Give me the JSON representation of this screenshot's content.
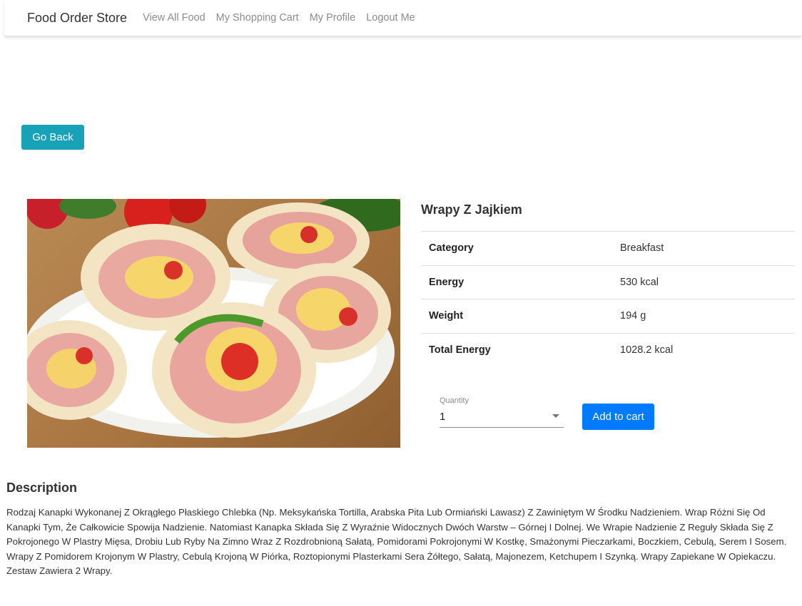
{
  "navbar": {
    "brand": "Food Order Store",
    "links": [
      "View All Food",
      "My Shopping Cart",
      "My Profile",
      "Logout Me"
    ]
  },
  "go_back_label": "Go Back",
  "food": {
    "title": "Wrapy Z Jajkiem",
    "details": [
      {
        "label": "Category",
        "value": "Breakfast"
      },
      {
        "label": "Energy",
        "value": "530 kcal"
      },
      {
        "label": "Weight",
        "value": "194 g"
      },
      {
        "label": "Total Energy",
        "value": "1028.2 kcal"
      }
    ]
  },
  "quantity": {
    "label": "Quantity",
    "value": "1"
  },
  "add_to_cart_label": "Add to cart",
  "description": {
    "heading": "Description",
    "text": "Rodzaj Kanapki Wykonanej Z Okrągłego Płaskiego Chlebka (Np. Meksykańska Tortilla, Arabska Pita Lub Ormiański Lawasz) Z Zawiniętym W Środku Nadzieniem. Wrap Różni Się Od Kanapki Tym, Że Całkowicie Spowija Nadzienie. Natomiast Kanapka Składa Się Z Wyraźnie Widocznych Dwóch Warstw – Górnej I Dolnej. We Wrapie Nadzienie Z Reguły Składa Się Z Pokrojonego W Plastry Mięsa, Drobiu Lub Ryby Na Zimno Wraz Z Rozdrobnioną Sałatą, Pomidorami Pokrojonymi W Kostkę, Smażonymi Pieczarkami, Boczkiem, Cebulą, Serem I Sosem. Wrapy Z Pomidorem Krojonym W Plastry, Cebulą Krojoną W Piórka, Roztopionymi Plasterkami Sera Żółtego, Sałatą, Majonezem, Ketchupem I Szynką. Wrapy Zapiekane W Opiekaczu. Zestaw Zawiera 2 Wrapy."
  },
  "colors": {
    "go_back": "#17a2b8",
    "add_to_cart": "#007bff",
    "nav_link": "#8c8c8c"
  },
  "icons": {
    "quantity_dropdown": "caret-down-icon"
  }
}
